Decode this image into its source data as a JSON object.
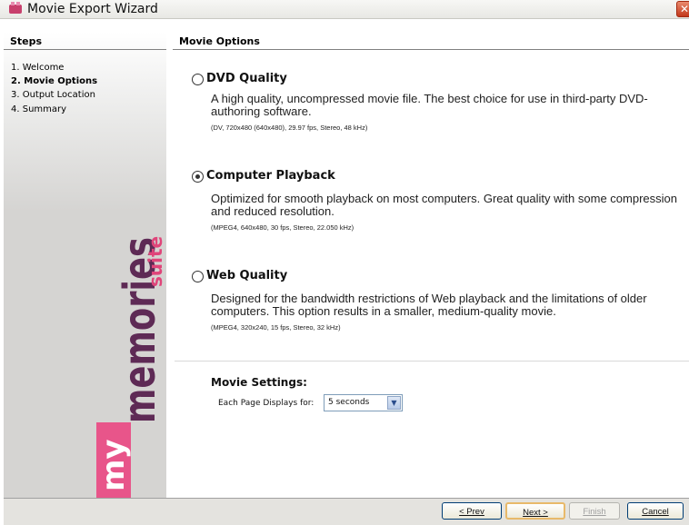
{
  "window": {
    "title": "Movie Export Wizard",
    "close_glyph": "✕"
  },
  "sidebar": {
    "heading": "Steps",
    "steps": [
      {
        "label": "1. Welcome",
        "active": false
      },
      {
        "label": "2. Movie Options",
        "active": true
      },
      {
        "label": "3. Output Location",
        "active": false
      },
      {
        "label": "4. Summary",
        "active": false
      }
    ],
    "logo": {
      "my": "my",
      "memories": "memories",
      "suite": "suite",
      "brand_pink": "#e0457a",
      "brand_purple": "#5e2a55"
    }
  },
  "main": {
    "heading": "Movie Options",
    "options": [
      {
        "title": "DVD Quality",
        "selected": false,
        "description": "A high quality, uncompressed movie file. The best choice for use in third-party DVD-authoring software.",
        "spec": "(DV, 720x480 (640x480), 29.97 fps, Stereo, 48 kHz)"
      },
      {
        "title": "Computer Playback",
        "selected": true,
        "description": "Optimized for smooth playback on most computers. Great quality with some compression and reduced resolution.",
        "spec": "(MPEG4, 640x480, 30 fps, Stereo, 22.050 kHz)"
      },
      {
        "title": "Web Quality",
        "selected": false,
        "description": "Designed for the bandwidth restrictions of Web playback and the limitations of older computers. This option results in a smaller, medium-quality movie.",
        "spec": "(MPEG4, 320x240, 15 fps, Stereo, 32 kHz)"
      }
    ],
    "settings": {
      "heading": "Movie Settings:",
      "page_display_label": "Each Page Displays for:",
      "page_display_value": "5 seconds",
      "dropdown_icon": "chevron-down-icon"
    }
  },
  "footer": {
    "prev_label": "< Prev",
    "next_label": "Next >",
    "finish_label": "Finish",
    "cancel_label": "Cancel"
  }
}
